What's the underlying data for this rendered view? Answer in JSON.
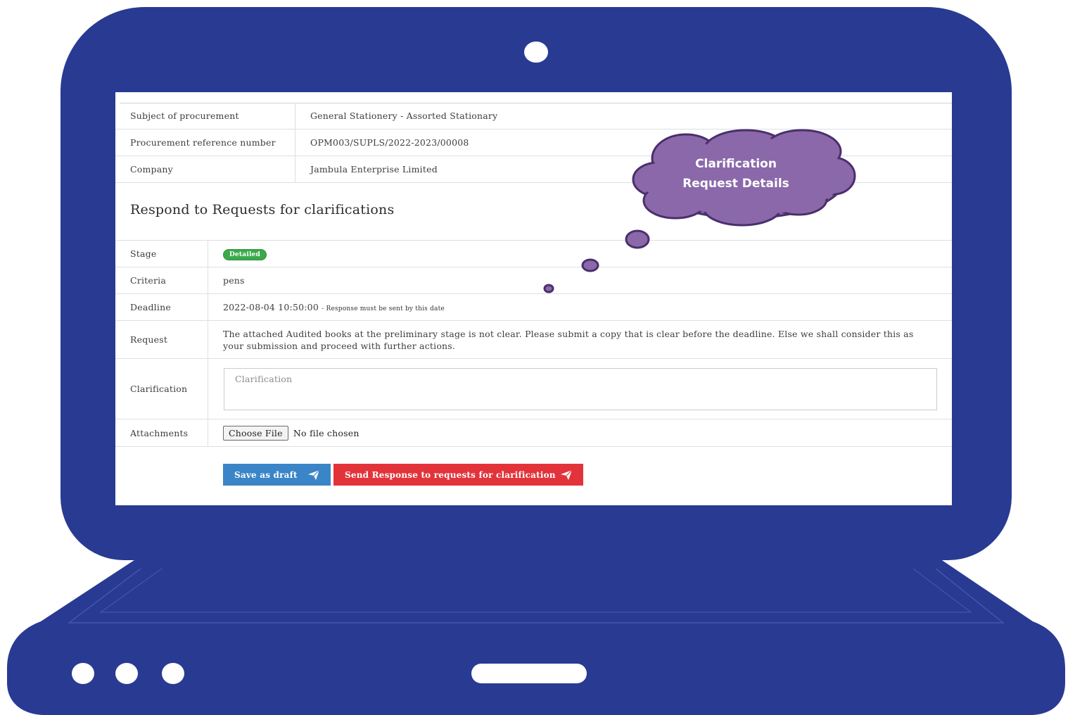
{
  "info": {
    "rows": [
      {
        "label": "Subject of procurement",
        "value": "General Stationery - Assorted Stationary"
      },
      {
        "label": "Procurement reference number",
        "value": "OPM003/SUPLS/2022-2023/00008"
      },
      {
        "label": "Company",
        "value": "Jambula Enterprise Limited"
      }
    ]
  },
  "section": {
    "title": "Respond to Requests for clarifications"
  },
  "details": {
    "stage_label": "Stage",
    "stage_badge": "Detailed",
    "criteria_label": "Criteria",
    "criteria_value": "pens",
    "deadline_label": "Deadline",
    "deadline_value": "2022-08-04 10:50:00",
    "deadline_note": "- Response must be sent by this date",
    "request_label": "Request",
    "request_value": "The attached Audited books at the preliminary stage is not clear. Please submit a copy that is clear before the deadline. Else we shall consider this as your submission and proceed with further actions.",
    "clarification_label": "Clarification",
    "clarification_placeholder": "Clarification",
    "attachments_label": "Attachments",
    "choose_file_label": "Choose File",
    "no_file_text": "No file chosen"
  },
  "actions": {
    "save_draft_label": "Save as draft",
    "send_label": "Send Response to requests for clarification"
  },
  "callout": {
    "line1": "Clarification",
    "line2": "Request Details"
  },
  "colors": {
    "frame": "#293a93",
    "badge_green": "#3aaa4b",
    "draft_blue": "#3a85c7",
    "send_red": "#e3333a",
    "cloud_purple": "#8a68aa"
  },
  "icons": {
    "send": "paper-plane-icon",
    "camera": "webcam-icon"
  }
}
